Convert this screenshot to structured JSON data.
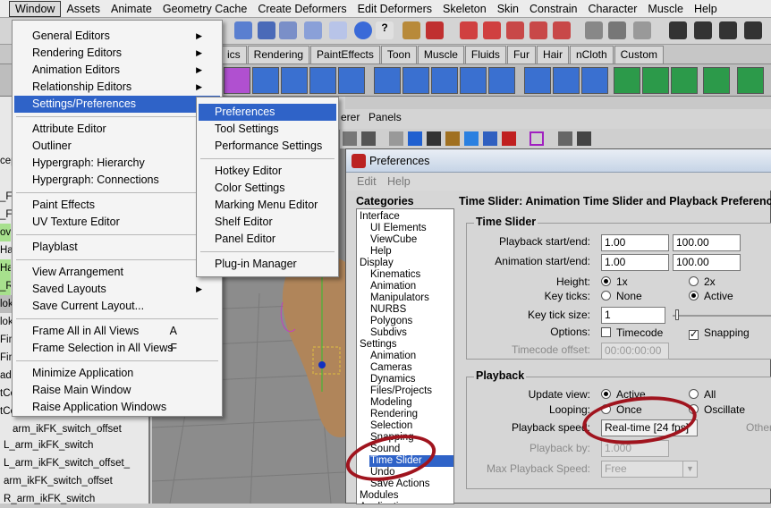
{
  "menubar": {
    "items": [
      "Window",
      "Assets",
      "Animate",
      "Geometry Cache",
      "Create Deformers",
      "Edit Deformers",
      "Skeleton",
      "Skin",
      "Constrain",
      "Character",
      "Muscle",
      "Help"
    ]
  },
  "shelf_tabs": [
    "ics",
    "Rendering",
    "PaintEffects",
    "Toon",
    "Muscle",
    "Fluids",
    "Fur",
    "Hair",
    "nCloth",
    "Custom"
  ],
  "panel_bar": {
    "items": [
      "erer",
      "Panels"
    ]
  },
  "window_menu": {
    "items": [
      {
        "label": "General Editors",
        "submenu": true
      },
      {
        "label": "Rendering Editors",
        "submenu": true
      },
      {
        "label": "Animation Editors",
        "submenu": true
      },
      {
        "label": "Relationship Editors",
        "submenu": true
      },
      {
        "label": "Settings/Preferences",
        "submenu": true
      },
      {
        "label": "Attribute Editor"
      },
      {
        "label": "Outliner"
      },
      {
        "label": "Hypergraph: Hierarchy"
      },
      {
        "label": "Hypergraph: Connections"
      },
      {
        "label": "Paint Effects"
      },
      {
        "label": "UV Texture Editor"
      },
      {
        "label": "Playblast"
      },
      {
        "label": "View Arrangement",
        "submenu": true
      },
      {
        "label": "Saved Layouts",
        "submenu": true
      },
      {
        "label": "Save Current Layout..."
      },
      {
        "label": "Frame All in All Views",
        "key": "A"
      },
      {
        "label": "Frame Selection in All Views",
        "key": "F"
      },
      {
        "label": "Minimize Application"
      },
      {
        "label": "Raise Main Window"
      },
      {
        "label": "Raise Application Windows"
      }
    ]
  },
  "settings_submenu": {
    "items": [
      "Preferences",
      "Tool Settings",
      "Performance Settings",
      "Hotkey Editor",
      "Color Settings",
      "Marking Menu Editor",
      "Shelf Editor",
      "Panel Editor",
      "Plug-in Manager"
    ]
  },
  "outliner": {
    "rows": [
      "cep",
      "_FK",
      "_FK",
      "ov",
      "Ha",
      "Ha",
      "_R",
      "lok",
      "lok",
      "Fin",
      "Fin",
      "ad0",
      "tCo",
      "tCo",
      "ad0",
      "ad0"
    ],
    "bottom_rows": [
      "arm_ikFK_switch_offset",
      "L_arm_ikFK_switch",
      "L_arm_ikFK_switch_offset_",
      "arm_ikFK_switch_offset",
      "R_arm_ikFK_switch"
    ]
  },
  "preferences": {
    "title": "Preferences",
    "menu": [
      "Edit",
      "Help"
    ],
    "categories_label": "Categories",
    "categories": [
      {
        "label": "Interface",
        "level": 0
      },
      {
        "label": "UI Elements",
        "level": 1
      },
      {
        "label": "ViewCube",
        "level": 1
      },
      {
        "label": "Help",
        "level": 1
      },
      {
        "label": "Display",
        "level": 0
      },
      {
        "label": "Kinematics",
        "level": 1
      },
      {
        "label": "Animation",
        "level": 1
      },
      {
        "label": "Manipulators",
        "level": 1
      },
      {
        "label": "NURBS",
        "level": 1
      },
      {
        "label": "Polygons",
        "level": 1
      },
      {
        "label": "Subdivs",
        "level": 1
      },
      {
        "label": "Settings",
        "level": 0
      },
      {
        "label": "Animation",
        "level": 1
      },
      {
        "label": "Cameras",
        "level": 1
      },
      {
        "label": "Dynamics",
        "level": 1
      },
      {
        "label": "Files/Projects",
        "level": 1
      },
      {
        "label": "Modeling",
        "level": 1
      },
      {
        "label": "Rendering",
        "level": 1
      },
      {
        "label": "Selection",
        "level": 1
      },
      {
        "label": "Snapping",
        "level": 1
      },
      {
        "label": "Sound",
        "level": 1
      },
      {
        "label": "Time Slider",
        "level": 1,
        "selected": true
      },
      {
        "label": "Undo",
        "level": 1
      },
      {
        "label": "Save Actions",
        "level": 1
      },
      {
        "label": "Modules",
        "level": 0
      },
      {
        "label": "Applications",
        "level": 0
      }
    ],
    "heading": "Time Slider: Animation Time Slider and Playback Preferences",
    "time_slider": {
      "title": "Time Slider",
      "playback_label": "Playback start/end:",
      "playback_start": "1.00",
      "playback_end": "100.00",
      "animation_label": "Animation start/end:",
      "animation_start": "1.00",
      "animation_end": "100.00",
      "height_label": "Height:",
      "height_opt1": "1x",
      "height_opt2": "2x",
      "keyticks_label": "Key ticks:",
      "keyticks_opt1": "None",
      "keyticks_opt2": "Active",
      "keytick_size_label": "Key tick size:",
      "keytick_size": "1",
      "options_label": "Options:",
      "timecode": "Timecode",
      "snapping": "Snapping",
      "timecode_offset_label": "Timecode offset:",
      "timecode_offset": "00:00:00:00"
    },
    "playback": {
      "title": "Playback",
      "update_view_label": "Update view:",
      "update_opt1": "Active",
      "update_opt2": "All",
      "looping_label": "Looping:",
      "looping_opt1": "Once",
      "looping_opt2": "Oscillate",
      "speed_label": "Playback speed:",
      "speed_value": "Real-time [24 fps]",
      "other": "Other",
      "playback_by_label": "Playback by:",
      "playback_by": "1.000",
      "max_speed_label": "Max Playback Speed:",
      "max_speed": "Free"
    }
  }
}
